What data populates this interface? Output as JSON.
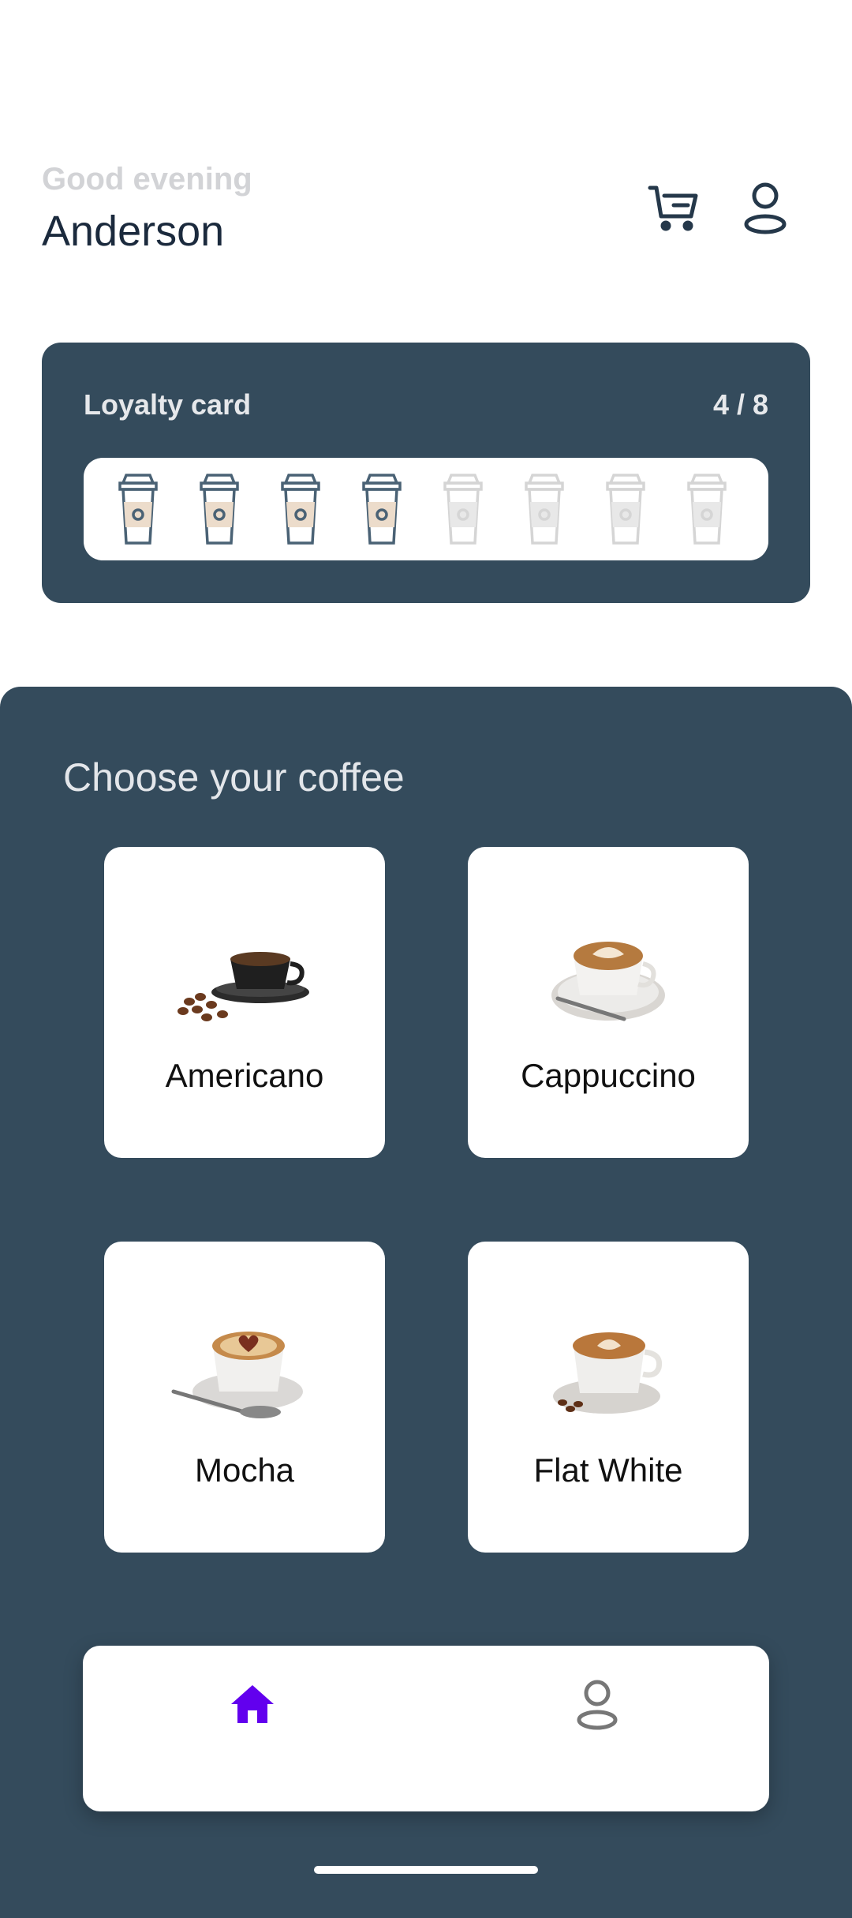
{
  "header": {
    "greeting": "Good evening",
    "username": "Anderson",
    "icons": [
      "cart-icon",
      "profile-icon"
    ]
  },
  "loyalty": {
    "title": "Loyalty card",
    "count": "4 / 8",
    "collected": 4,
    "total": 8
  },
  "menu": {
    "title": "Choose your coffee",
    "items": [
      {
        "label": "Americano",
        "icon": "americano-image"
      },
      {
        "label": "Cappuccino",
        "icon": "cappuccino-image"
      },
      {
        "label": "Mocha",
        "icon": "mocha-image"
      },
      {
        "label": "Flat White",
        "icon": "flat-white-image"
      }
    ]
  },
  "nav": {
    "items": [
      "home-icon",
      "profile-icon"
    ],
    "active": "home"
  },
  "colors": {
    "panel": "#344b5c",
    "accent": "#6200ee",
    "text_dark": "#1b2a3d",
    "greeting": "#d2d3d6"
  }
}
